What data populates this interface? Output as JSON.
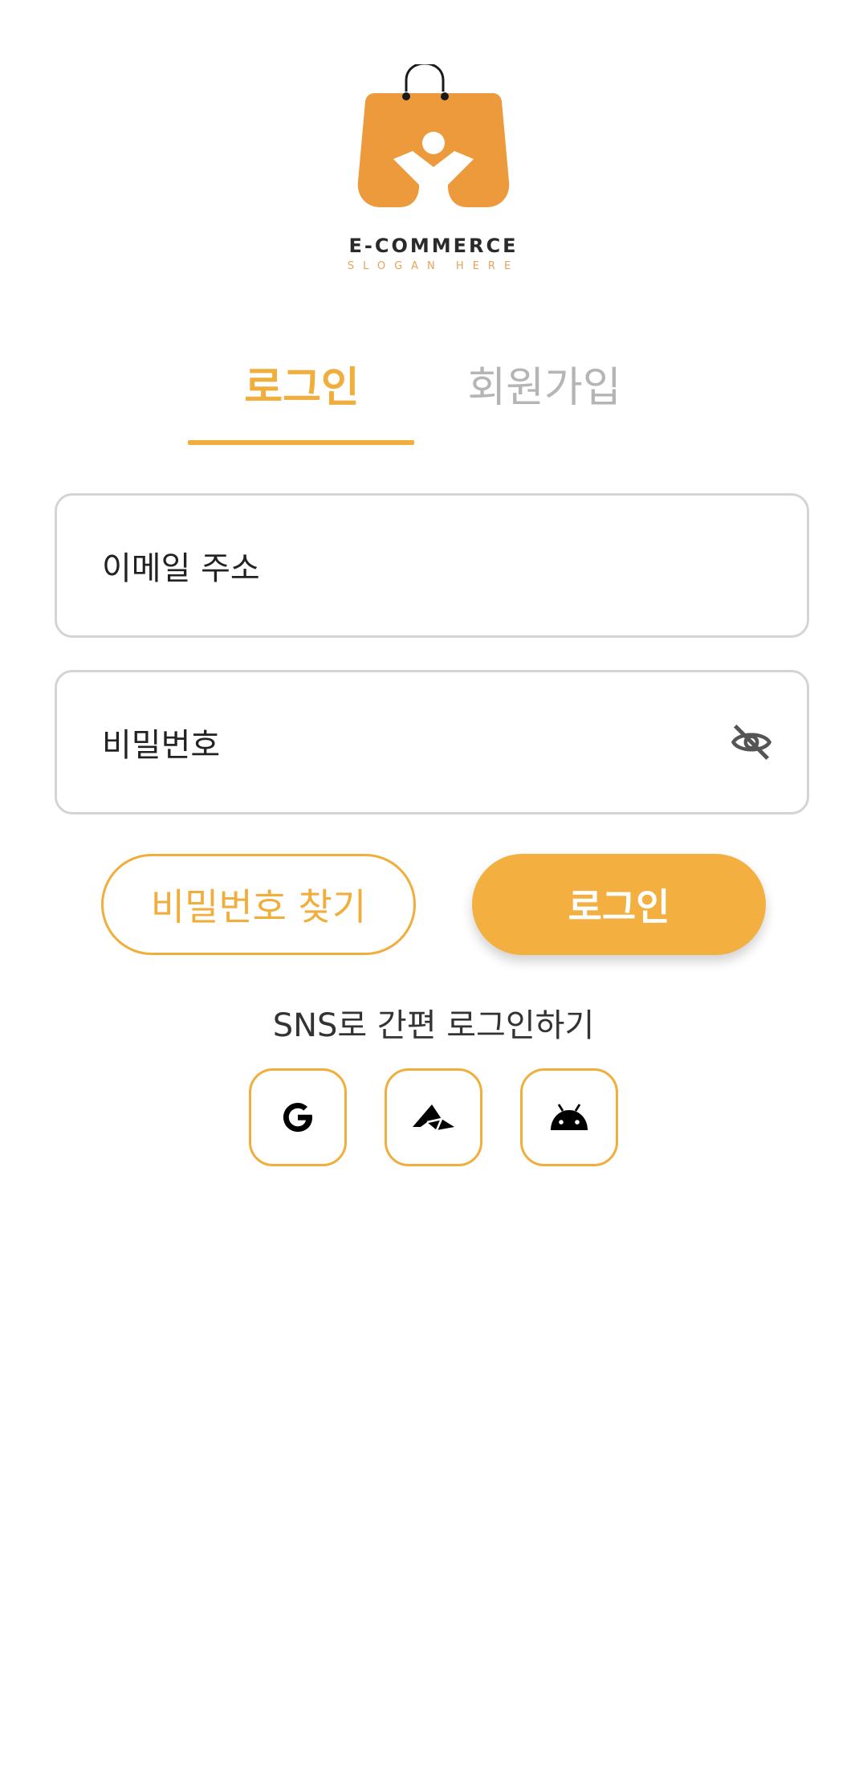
{
  "brand": {
    "name": "E-COMMERCE",
    "slogan": "SLOGAN HERE",
    "colors": {
      "bag": "#ec9a3c",
      "handle": "#1a1a1a"
    }
  },
  "tabs": [
    {
      "label": "로그인",
      "active": true
    },
    {
      "label": "회원가입",
      "active": false
    }
  ],
  "form": {
    "email_placeholder": "이메일 주소",
    "password_placeholder": "비밀번호",
    "password_visibility_icon": "eye-off-icon"
  },
  "actions": {
    "find_password_label": "비밀번호 찾기",
    "login_label": "로그인"
  },
  "sns": {
    "title": "SNS로 간편 로그인하기",
    "providers": [
      {
        "icon": "google-icon"
      },
      {
        "icon": "paper-plane-icon"
      },
      {
        "icon": "android-icon"
      }
    ]
  },
  "colors": {
    "accent": "#f0ae3c",
    "tab_inactive": "#b5b5b5",
    "field_border": "#d4d4d4"
  }
}
